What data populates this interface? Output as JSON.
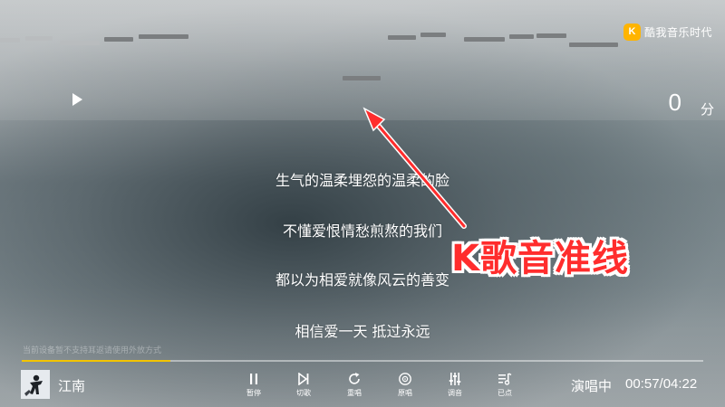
{
  "brand": {
    "logo_letter": "K",
    "name": "酷我音乐时代",
    "color": "#ffb400"
  },
  "score": {
    "value": "0",
    "unit": "分"
  },
  "lyrics": [
    "生气的温柔埋怨的温柔的脸",
    "不懂爱恨情愁煎熬的我们",
    "都以为相爱就像风云的善变",
    "相信爱一天 抵过永远"
  ],
  "annotation": {
    "text": "K歌音准线",
    "color": "#ff2d2d"
  },
  "notice": "当前设备暂不支持耳返请使用外放方式",
  "player": {
    "song_title": "江南",
    "status": "演唱中",
    "time": "00:57/04:22",
    "progress": 0.218,
    "progress_color": "#f3c400",
    "controls": [
      {
        "label": "暂停",
        "icon": "pause-icon"
      },
      {
        "label": "切歌",
        "icon": "skip-next-icon"
      },
      {
        "label": "重唱",
        "icon": "restart-icon"
      },
      {
        "label": "原唱",
        "icon": "original-vocal-icon"
      },
      {
        "label": "调音",
        "icon": "equalizer-icon"
      },
      {
        "label": "已点",
        "icon": "playlist-icon"
      }
    ]
  }
}
